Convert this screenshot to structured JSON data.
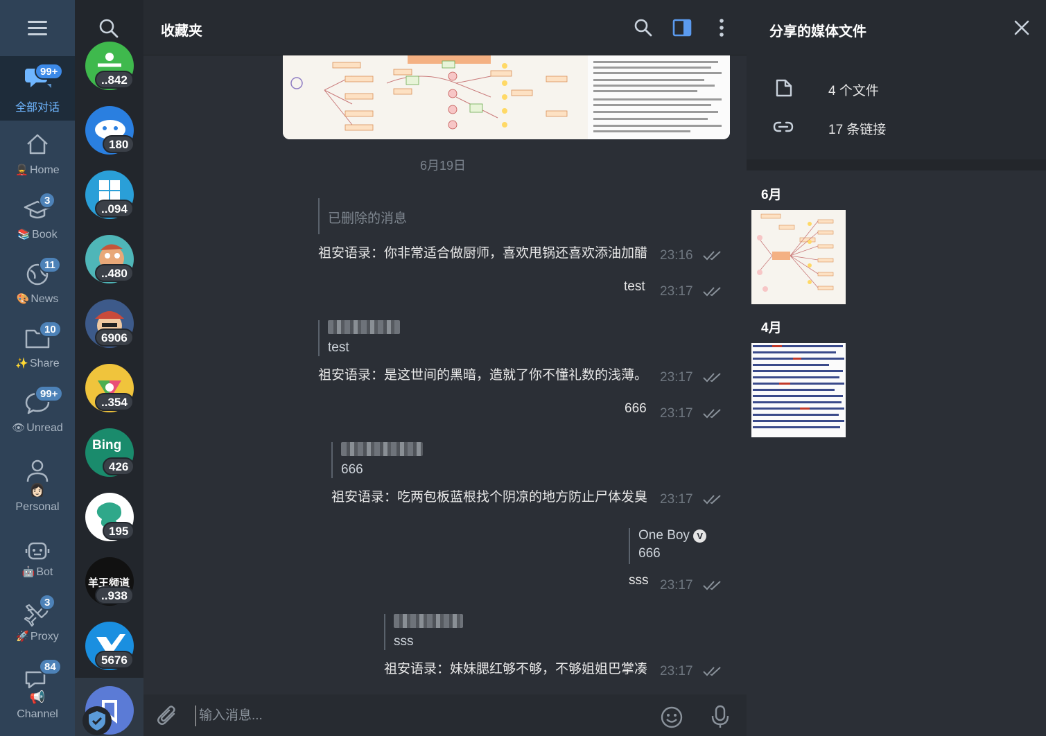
{
  "folders": [
    {
      "label": "全部对话",
      "badge": "99+",
      "emoji": "",
      "icon": "chats-icon"
    },
    {
      "label": "Home",
      "badge": "",
      "emoji": "💂",
      "icon": "home-icon"
    },
    {
      "label": "Book",
      "badge": "3",
      "emoji": "📚",
      "icon": "graduation-cap-icon"
    },
    {
      "label": "News",
      "badge": "11",
      "emoji": "🎨",
      "icon": "globe-icon"
    },
    {
      "label": "Share",
      "badge": "10",
      "emoji": "✨",
      "icon": "folder-icon"
    },
    {
      "label": "Unread",
      "badge": "99+",
      "emoji": "👁",
      "icon": "chat-bubble-icon"
    },
    {
      "label": "Personal",
      "badge": "",
      "emoji": "👩🏻",
      "icon": "person-icon"
    },
    {
      "label": "Bot",
      "badge": "",
      "emoji": "🤖",
      "icon": "robot-icon"
    },
    {
      "label": "Proxy",
      "badge": "3",
      "emoji": "🚀",
      "icon": "airplane-icon"
    },
    {
      "label": "Channel",
      "badge": "84",
      "emoji": "📢",
      "icon": "channel-icon"
    }
  ],
  "chats": [
    {
      "badge": "..842",
      "color": "#3fb94d"
    },
    {
      "badge": "180",
      "color": "#2a7fe0"
    },
    {
      "badge": "..094",
      "color": "#2a9fd8"
    },
    {
      "badge": "..480",
      "color": "#4fb6b8"
    },
    {
      "badge": "6906",
      "color": "#c94a3a"
    },
    {
      "badge": "..354",
      "color": "#f0c43c"
    },
    {
      "badge": "426",
      "color": "#1a8b6c",
      "text": "Bing"
    },
    {
      "badge": "195",
      "color": "#ffffff"
    },
    {
      "badge": "..938",
      "color": "#111111",
      "text": "羊王频道"
    },
    {
      "badge": "5676",
      "color": "#1a8fe0"
    }
  ],
  "header": {
    "title": "收藏夹"
  },
  "messages": {
    "date": "6月19日",
    "m1": {
      "reply_text": "已删除的消息",
      "text": "祖安语录：你非常适合做厨师，喜欢甩锅还喜欢添油加醋",
      "time": "23:16"
    },
    "m2": {
      "text": "test",
      "time": "23:17"
    },
    "m3": {
      "reply_text": "test",
      "text": "祖安语录：是这世间的黑暗，造就了你不懂礼数的浅薄。",
      "time": "23:17"
    },
    "m4": {
      "text": "666",
      "time": "23:17"
    },
    "m5": {
      "reply_text": "666",
      "text": "祖安语录：吃两包板蓝根找个阴凉的地方防止尸体发臭",
      "time": "23:17"
    },
    "m6": {
      "reply_name": "One Boy",
      "reply_text": "666",
      "text": "sss",
      "time": "23:17"
    },
    "m7": {
      "reply_text": "sss",
      "text": "祖安语录：妹妹腮红够不够，不够姐姐巴掌凑",
      "time": "23:17"
    }
  },
  "composer": {
    "placeholder": "输入消息..."
  },
  "panel": {
    "title": "分享的媒体文件",
    "files": "4 个文件",
    "links": "17 条链接",
    "month1": "6月",
    "month2": "4月"
  },
  "colors": {
    "accent": "#6fb6ff",
    "badge": "#4d82b8"
  }
}
